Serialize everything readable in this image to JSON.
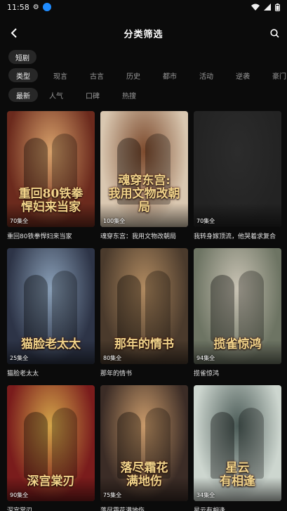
{
  "status": {
    "time": "11:58"
  },
  "header": {
    "title": "分类筛选"
  },
  "filters": {
    "format": [
      {
        "label": "短剧",
        "active": true
      }
    ],
    "genre": [
      {
        "label": "类型",
        "active": true
      },
      {
        "label": "现言",
        "active": false
      },
      {
        "label": "古言",
        "active": false
      },
      {
        "label": "历史",
        "active": false
      },
      {
        "label": "都市",
        "active": false
      },
      {
        "label": "活动",
        "active": false
      },
      {
        "label": "逆袭",
        "active": false
      },
      {
        "label": "豪门",
        "active": false
      }
    ],
    "sort": [
      {
        "label": "最新",
        "active": true
      },
      {
        "label": "人气",
        "active": false
      },
      {
        "label": "口碑",
        "active": false
      },
      {
        "label": "热搜",
        "active": false
      }
    ]
  },
  "dramas": [
    {
      "name": "重回80铁拳悍妇来当家",
      "episodes": "70集全",
      "poster_text": "重回80铁拳\n悍妇来当家",
      "bg": "#6b2a1d",
      "accent": "#d8a26b"
    },
    {
      "name": "魂穿东宫：我用文物改朝局",
      "episodes": "100集全",
      "poster_text": "魂穿东宫:\n我用文物改朝局",
      "bg": "#d9c7b0",
      "accent": "#7c4a2d"
    },
    {
      "name": "我转身嫁顶流，他哭着求复合",
      "episodes": "70集全",
      "poster_text": "",
      "bg": "#232323",
      "accent": "#2c2c2c"
    },
    {
      "name": "猫脸老太太",
      "episodes": "25集全",
      "poster_text": "猫脸老太太",
      "bg": "#2d3447",
      "accent": "#8aa0b8"
    },
    {
      "name": "那年的情书",
      "episodes": "80集全",
      "poster_text": "那年的情书",
      "bg": "#4a3a2c",
      "accent": "#b08a60"
    },
    {
      "name": "揽雀惊鸿",
      "episodes": "94集全",
      "poster_text": "揽雀惊鸿",
      "bg": "#6d7463",
      "accent": "#c9c3b4"
    },
    {
      "name": "深宫棠刃",
      "episodes": "90集全",
      "poster_text": "深宫棠刃",
      "bg": "#7a1c1c",
      "accent": "#d4a64a"
    },
    {
      "name": "落尽霜花满地伤",
      "episodes": "75集全",
      "poster_text": "落尽霜花\n满地伤",
      "bg": "#3b2c26",
      "accent": "#c99a6a"
    },
    {
      "name": "星云有相逢",
      "episodes": "34集全",
      "poster_text": "星云\n有相逢",
      "bg": "#cdd6cf",
      "accent": "#4b5b57"
    }
  ]
}
